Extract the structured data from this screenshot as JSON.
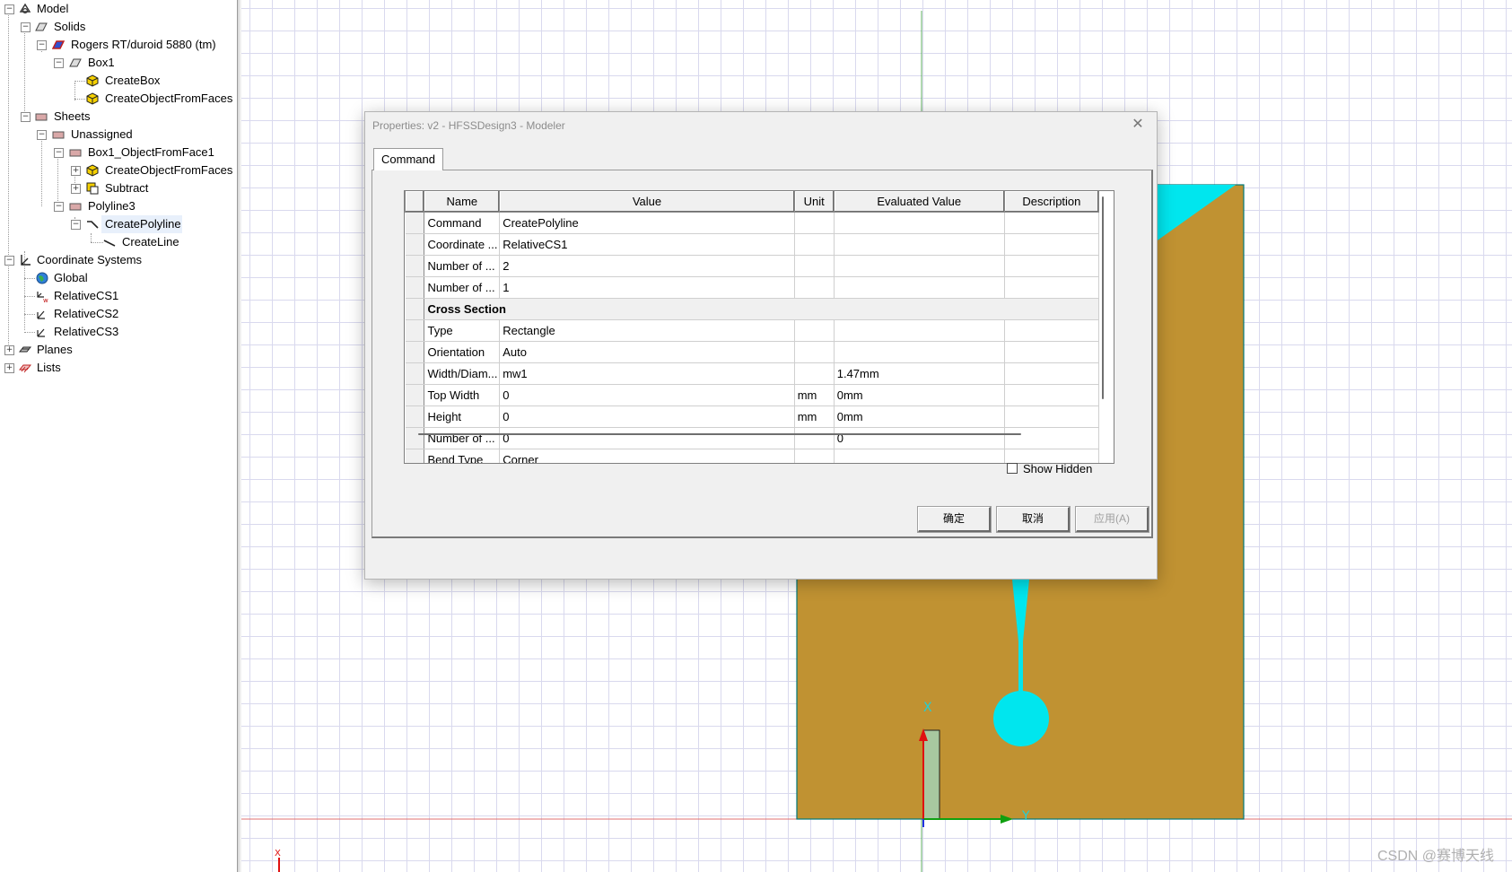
{
  "tree": {
    "items": [
      {
        "label": "Model"
      },
      {
        "label": "Solids"
      },
      {
        "label": "Rogers RT/duroid 5880 (tm)"
      },
      {
        "label": "Box1"
      },
      {
        "label": "CreateBox"
      },
      {
        "label": "CreateObjectFromFaces"
      },
      {
        "label": "Sheets"
      },
      {
        "label": "Unassigned"
      },
      {
        "label": "Box1_ObjectFromFace1"
      },
      {
        "label": "CreateObjectFromFaces"
      },
      {
        "label": "Subtract"
      },
      {
        "label": "Polyline3"
      },
      {
        "label": "CreatePolyline"
      },
      {
        "label": "CreateLine"
      },
      {
        "label": "Coordinate Systems"
      },
      {
        "label": "Global"
      },
      {
        "label": "RelativeCS1"
      },
      {
        "label": "RelativeCS2"
      },
      {
        "label": "RelativeCS3"
      },
      {
        "label": "Planes"
      },
      {
        "label": "Lists"
      }
    ]
  },
  "dialog": {
    "title": "Properties: v2 - HFSSDesign3 - Modeler",
    "tab": "Command",
    "columns": [
      "Name",
      "Value",
      "Unit",
      "Evaluated Value",
      "Description"
    ],
    "rows": [
      {
        "name": "Command",
        "value": "CreatePolyline",
        "unit": "",
        "evaluated": "",
        "description": ""
      },
      {
        "name": "Coordinate ...",
        "value": "RelativeCS1",
        "unit": "",
        "evaluated": "",
        "description": ""
      },
      {
        "name": "Number of ...",
        "value": "2",
        "unit": "",
        "evaluated": "",
        "description": ""
      },
      {
        "name": "Number of ...",
        "value": "1",
        "unit": "",
        "evaluated": "",
        "description": ""
      },
      {
        "section": "Cross Section"
      },
      {
        "name": "Type",
        "value": "Rectangle",
        "unit": "",
        "evaluated": "",
        "description": ""
      },
      {
        "name": "Orientation",
        "value": "Auto",
        "unit": "",
        "evaluated": "",
        "description": ""
      },
      {
        "name": "Width/Diam...",
        "value": "mw1",
        "unit": "",
        "evaluated": "1.47mm",
        "description": ""
      },
      {
        "name": "Top Width",
        "value": "0",
        "unit": "mm",
        "evaluated": "0mm",
        "description": ""
      },
      {
        "name": "Height",
        "value": "0",
        "unit": "mm",
        "evaluated": "0mm",
        "description": ""
      },
      {
        "name": "Number of ...",
        "value": "0",
        "unit": "",
        "evaluated": "0",
        "description": ""
      },
      {
        "name": "Bend Type",
        "value": "Corner",
        "unit": "",
        "evaluated": "",
        "description": ""
      }
    ],
    "show_hidden_label": "Show Hidden",
    "buttons": {
      "ok": "确定",
      "cancel": "取消",
      "apply": "应用(A)"
    }
  },
  "canvas": {
    "axis_x_label": "X",
    "axis_y_label": "Y",
    "origin_marker_label": "X",
    "colors": {
      "substrate": "#c09232",
      "conductor": "#00e6ee",
      "grid": "#d9d9ee",
      "red_axis": "#e01010",
      "green_axis": "#10a010"
    }
  },
  "watermark": "CSDN @赛博天线"
}
